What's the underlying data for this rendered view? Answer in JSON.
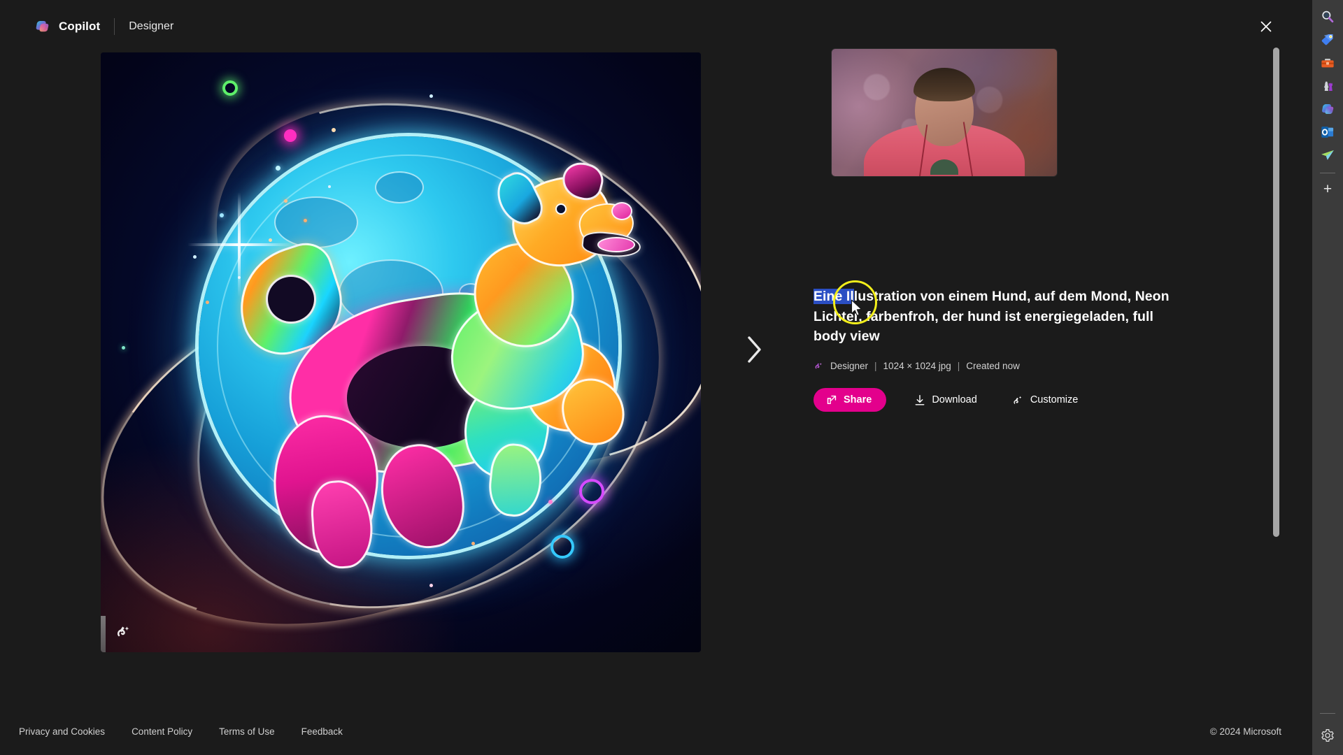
{
  "header": {
    "logo_icon": "copilot-logo-icon",
    "brand": "Copilot",
    "product": "Designer",
    "close_icon": "close-icon"
  },
  "image_card": {
    "watermark_icon": "designer-watermark-icon",
    "alt": "Neon illustration of a dog leaping in front of a glowing cyan moon in space"
  },
  "navigation": {
    "next_icon": "chevron-right-icon"
  },
  "detail": {
    "prompt_selected": "Eine Il",
    "prompt_rest": "lustration von einem Hund, auf dem Mond, Neon Lichter, farbenfroh, der hund ist energiegeladen, full body view",
    "meta": {
      "source_icon": "designer-icon",
      "source": "Designer",
      "separator": "|",
      "dimensions": "1024 × 1024 jpg",
      "created": "Created now"
    },
    "actions": {
      "share": {
        "label": "Share",
        "icon": "share-icon",
        "color": "#e3008c"
      },
      "download": {
        "label": "Download",
        "icon": "download-icon"
      },
      "customize": {
        "label": "Customize",
        "icon": "magic-wand-icon"
      }
    }
  },
  "webcam": {
    "label": "webcam-overlay"
  },
  "cursor": {
    "ring_color": "#f2ee1a",
    "pointer_icon": "mouse-pointer-icon"
  },
  "footer": {
    "links": [
      "Privacy and Cookies",
      "Content Policy",
      "Terms of Use",
      "Feedback"
    ],
    "copyright": "© 2024 Microsoft"
  },
  "edge_sidebar": {
    "items": [
      {
        "icon": "search-icon",
        "name": "search"
      },
      {
        "icon": "shopping-tag-icon",
        "name": "shopping"
      },
      {
        "icon": "toolbox-icon",
        "name": "tools"
      },
      {
        "icon": "games-icon",
        "name": "games"
      },
      {
        "icon": "copilot-icon",
        "name": "copilot"
      },
      {
        "icon": "outlook-icon",
        "name": "outlook"
      },
      {
        "icon": "drop-icon",
        "name": "drop"
      }
    ],
    "add_label": "+",
    "settings_icon": "gear-icon"
  }
}
